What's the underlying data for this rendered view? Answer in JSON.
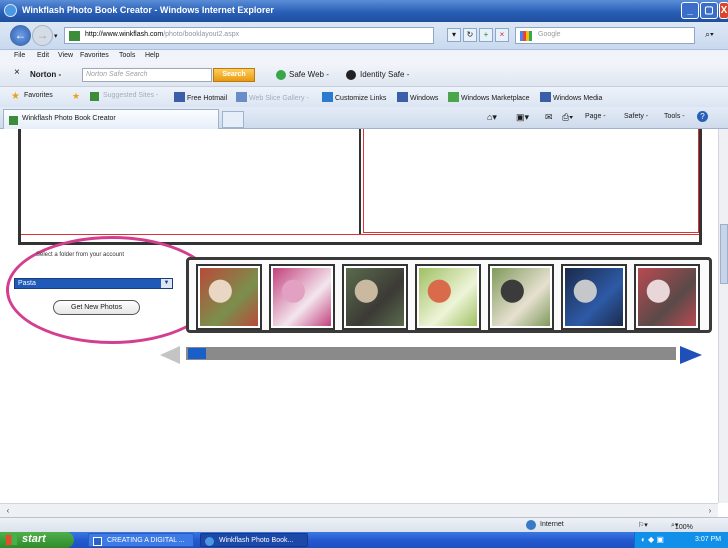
{
  "window": {
    "title": "Winkflash Photo Book Creator - Windows Internet Explorer",
    "buttons": {
      "minimize": "_",
      "maximize": "▢",
      "close": "X"
    }
  },
  "address": {
    "url_domain": "http://www.winkflash.com",
    "url_path": "/photo/booklayout2.aspx",
    "search_placeholder": "Google"
  },
  "menu": [
    "File",
    "Edit",
    "View",
    "Favorites",
    "Tools",
    "Help"
  ],
  "norton": {
    "close": "×",
    "brand": "Norton -",
    "search_placeholder": "Norton Safe Search",
    "search_button": "Search",
    "safe_web": "Safe Web -",
    "identity_safe": "Identity Safe -"
  },
  "favorites_bar": {
    "favorites": "Favorites",
    "suggested": "Suggested Sites -",
    "hotmail": "Free Hotmail",
    "web_slice": "Web Slice Gallery -",
    "customize": "Customize Links",
    "windows": "Windows",
    "marketplace": "Windows Marketplace",
    "media": "Windows Media"
  },
  "tab": {
    "label": "Winkflash Photo Book Creator"
  },
  "command_bar": {
    "page": "Page -",
    "safety": "Safety -",
    "tools": "Tools -"
  },
  "content": {
    "folder_label": "Select a folder from your account",
    "folder_selected": "Pasta",
    "get_photos_button": "Get New Photos",
    "thumbnails": [
      {
        "name": "thumb-1",
        "colors": [
          "#b94a3a",
          "#e9d7c4",
          "#7a8f4c"
        ]
      },
      {
        "name": "thumb-2",
        "colors": [
          "#c2417d",
          "#e2a0c2",
          "#f3e6ee"
        ]
      },
      {
        "name": "thumb-3",
        "colors": [
          "#5a6b4c",
          "#c9b9a1",
          "#3c3a36"
        ]
      },
      {
        "name": "thumb-4",
        "colors": [
          "#9fc063",
          "#d96a4a",
          "#eef4d8"
        ]
      },
      {
        "name": "thumb-5",
        "colors": [
          "#7f9a5b",
          "#3b3b3b",
          "#e6e0d0"
        ]
      },
      {
        "name": "thumb-6",
        "colors": [
          "#1c2a4a",
          "#c6c7ca",
          "#2d5aa6"
        ]
      },
      {
        "name": "thumb-7",
        "colors": [
          "#b84a52",
          "#e9d6d8",
          "#5a4a48"
        ]
      }
    ]
  },
  "status": {
    "zone": "Internet",
    "zoom": "100%"
  },
  "taskbar": {
    "start": "start",
    "items": [
      {
        "label": "CREATING A DIGITAL ...",
        "active": false
      },
      {
        "label": "Winkflash Photo Book...",
        "active": true
      }
    ],
    "clock": "3:07 PM"
  },
  "colors": {
    "accent": "#2a5fb8",
    "highlight_circle": "#d43e8f",
    "scroll_arrow": "#1f4fb8"
  }
}
